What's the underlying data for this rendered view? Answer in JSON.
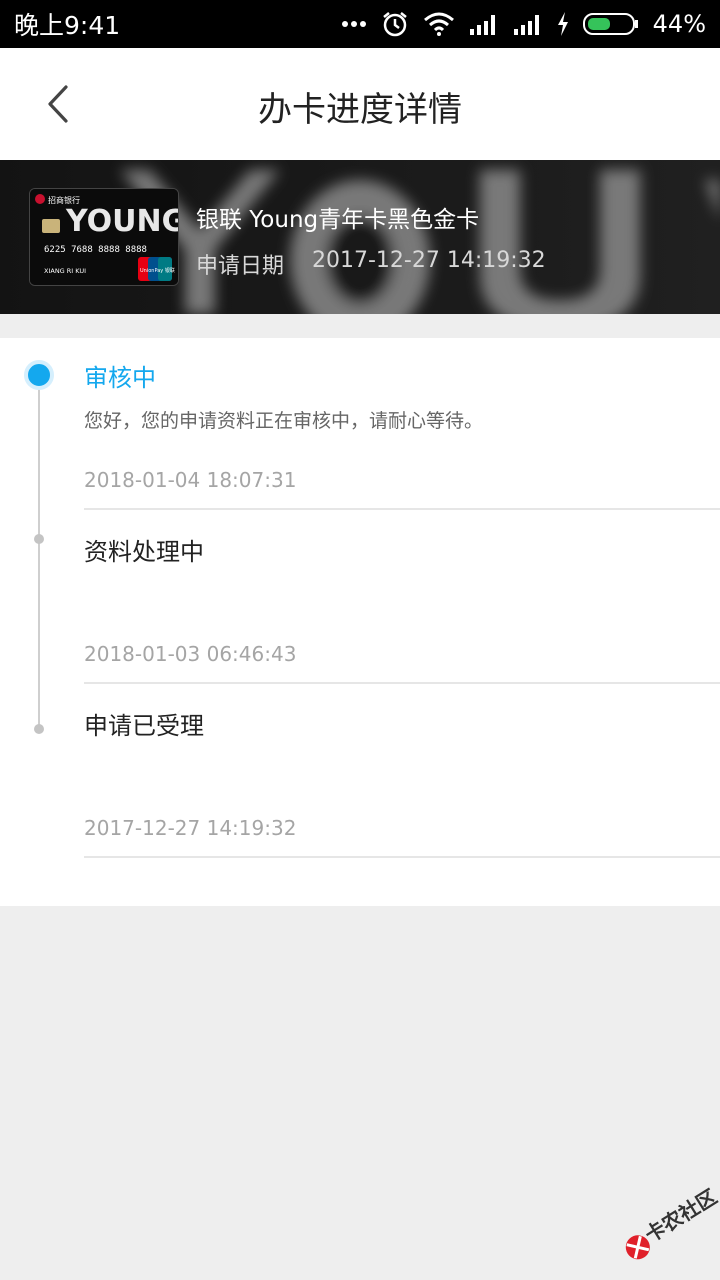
{
  "status_bar": {
    "time": "晚上9:41",
    "battery": "44%",
    "icons": [
      "more-dots-icon",
      "alarm-icon",
      "wifi-icon",
      "signal-icon",
      "signal-icon",
      "charging-icon",
      "battery-icon"
    ]
  },
  "nav": {
    "title": "办卡进度详情",
    "back_icon": "chevron-left-icon"
  },
  "card": {
    "name": "银联 Young青年卡黑色金卡",
    "apply_date_label": "申请日期",
    "apply_date": "2017-12-27 14:19:32",
    "image": {
      "bank": "招商银行",
      "brand": "YOUNG",
      "number": "6225  7688  8888  8888",
      "holder": "XIANG RI KUI",
      "network": "UnionPay 银联"
    }
  },
  "progress": {
    "steps": [
      {
        "title": "审核中",
        "desc": "您好，您的申请资料正在审核中，请耐心等待。",
        "time": "2018-01-04 18:07:31",
        "active": true
      },
      {
        "title": "资料处理中",
        "desc": "",
        "time": "2018-01-03 06:46:43",
        "active": false
      },
      {
        "title": "申请已受理",
        "desc": "",
        "time": "2017-12-27 14:19:32",
        "active": false
      }
    ]
  },
  "watermark": {
    "text": "卡农社区"
  },
  "colors": {
    "accent": "#14a8ee",
    "title": "#222222",
    "muted": "#a5a5a5"
  }
}
